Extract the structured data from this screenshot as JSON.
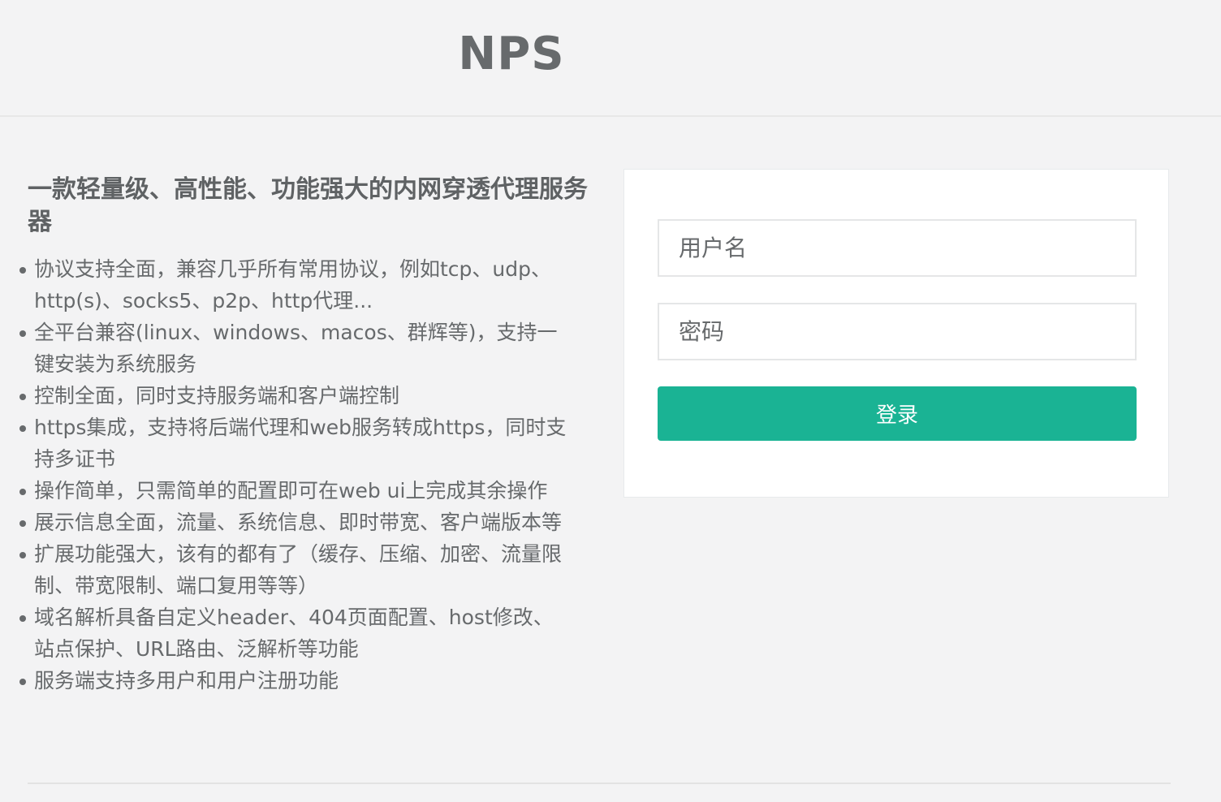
{
  "header": {
    "logo": "NPS"
  },
  "intro": {
    "title": "一款轻量级、高性能、功能强大的内网穿透代理服务器",
    "features": [
      "协议支持全面，兼容几乎所有常用协议，例如tcp、udp、http(s)、socks5、p2p、http代理...",
      "全平台兼容(linux、windows、macos、群辉等)，支持一键安装为系统服务",
      "控制全面，同时支持服务端和客户端控制",
      "https集成，支持将后端代理和web服务转成https，同时支持多证书",
      "操作简单，只需简单的配置即可在web ui上完成其余操作",
      "展示信息全面，流量、系统信息、即时带宽、客户端版本等",
      "扩展功能强大，该有的都有了（缓存、压缩、加密、流量限制、带宽限制、端口复用等等）",
      "域名解析具备自定义header、404页面配置、host修改、站点保护、URL路由、泛解析等功能",
      "服务端支持多用户和用户注册功能"
    ]
  },
  "login": {
    "username_placeholder": "用户名",
    "password_placeholder": "密码",
    "submit_label": "登录"
  },
  "colors": {
    "accent": "#1ab394",
    "text": "#676a6c",
    "background": "#f3f3f4"
  }
}
